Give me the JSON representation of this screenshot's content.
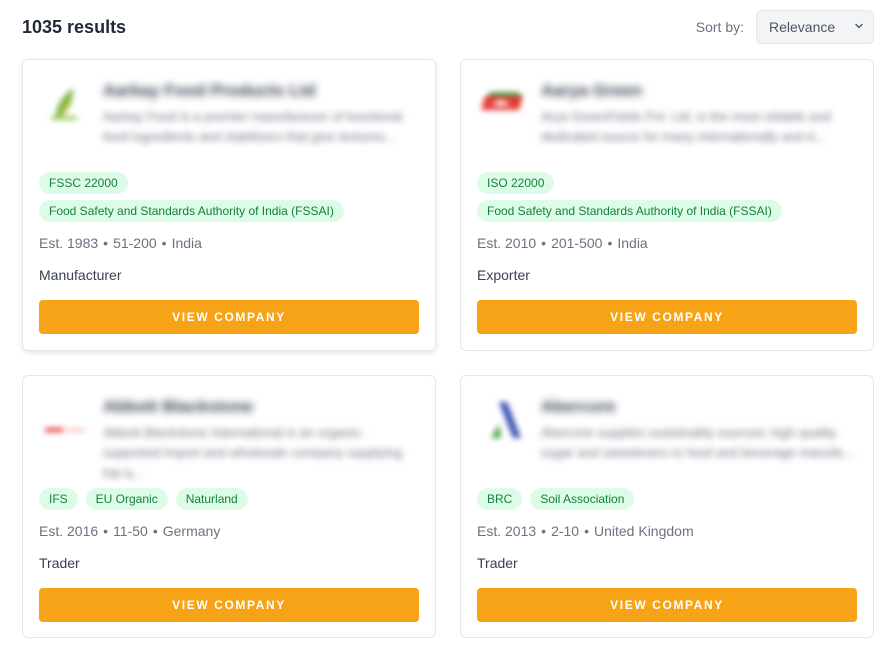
{
  "header": {
    "results_count": "1035 results",
    "sort_label": "Sort by:",
    "sort_value": "Relevance"
  },
  "companies": [
    {
      "name": "Aarkay Food Products Ltd",
      "description": "Aarkay Food is a premier manufacturer of functional food ingredients and stabilizers that give textures...",
      "certifications": [
        "FSSC 22000",
        "Food Safety and Standards Authority of India (FSSAI)"
      ],
      "established": "Est. 1983",
      "size": "51-200",
      "country": "India",
      "type": "Manufacturer",
      "button": "VIEW COMPANY",
      "logo_icon": "green-leaf-logo-icon"
    },
    {
      "name": "Aarya Green",
      "description": "Arya GreenFields Pvt. Ltd. is the most reliable and dedicated source for many internationally and d...",
      "certifications": [
        "ISO 22000",
        "Food Safety and Standards Authority of India (FSSAI)"
      ],
      "established": "Est. 2010",
      "size": "201-500",
      "country": "India",
      "type": "Exporter",
      "button": "VIEW COMPANY",
      "logo_icon": "red-badge-logo-icon"
    },
    {
      "name": "Abbott Blackstone",
      "description": "Abbott Blackstone International is an organic-supported import and wholesale company supplying top q...",
      "certifications": [
        "IFS",
        "EU Organic",
        "Naturland"
      ],
      "established": "Est. 2016",
      "size": "11-50",
      "country": "Germany",
      "type": "Trader",
      "button": "VIEW COMPANY",
      "logo_icon": "red-wordmark-logo-icon"
    },
    {
      "name": "Abercore",
      "description": "Abercore supplies sustainably sourced, high quality sugar and sweeteners to food and beverage manufa...",
      "certifications": [
        "BRC",
        "Soil Association"
      ],
      "established": "Est. 2013",
      "size": "2-10",
      "country": "United Kingdom",
      "type": "Trader",
      "button": "VIEW COMPANY",
      "logo_icon": "blue-a-logo-icon"
    }
  ],
  "colors": {
    "accent_button": "#f6a317",
    "tag_bg": "#dcfce7",
    "tag_text": "#15803d"
  }
}
